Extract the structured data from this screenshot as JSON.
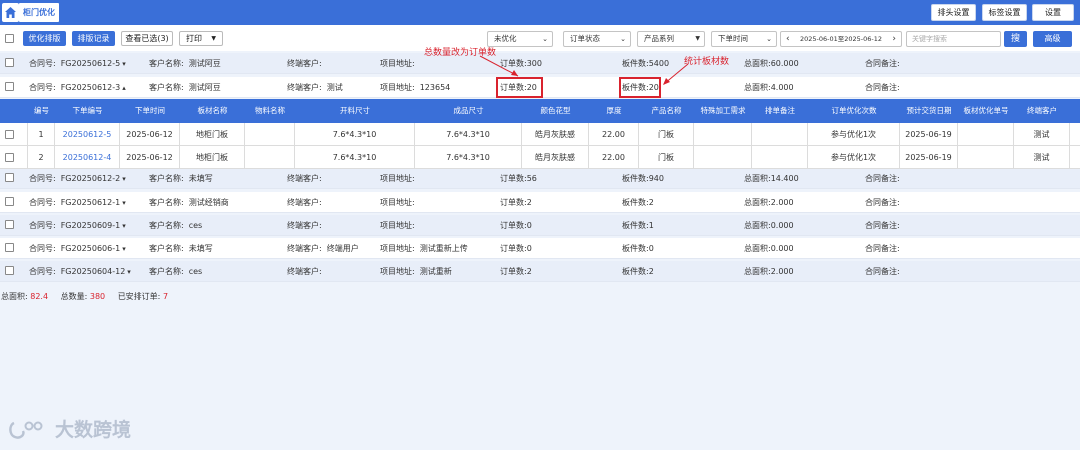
{
  "app": {
    "tab_label": "柜门优化"
  },
  "top_buttons": {
    "header_settings": "排头设置",
    "label_settings": "标签设置",
    "settings": "设置"
  },
  "toolbar": {
    "optimize_btn": "优化排版",
    "record_btn": "排版记录",
    "view_selected_btn": "查看已选(3)",
    "print_btn": "打印",
    "filter_optimize": "未优化",
    "filter_status": "订单状态",
    "filter_series": "产品系列",
    "filter_time": "下单时间",
    "date_range": "2025-06-01至2025-06-12",
    "search_placeholder": "关键字搜索",
    "search_btn": "搜",
    "advanced_btn": "高级"
  },
  "labels": {
    "contract": "合同号:",
    "customer": "客户名称:",
    "terminal": "终端客户:",
    "address": "项目地址:",
    "orders": "订单数:",
    "boards": "板件数:",
    "area": "总面积:",
    "remark": "合同备注:"
  },
  "orders": [
    {
      "contract": "FG20250612-5",
      "customer": "测试阿豆",
      "terminal": "",
      "address": "",
      "orders": "300",
      "boards": "5400",
      "area": "60.000",
      "remark": ""
    },
    {
      "contract": "FG20250612-3",
      "customer": "测试阿豆",
      "terminal": "测试",
      "address": "123654",
      "orders": "20",
      "boards": "20",
      "area": "4.000",
      "remark": ""
    },
    {
      "contract": "FG20250612-2",
      "customer": "未填写",
      "terminal": "",
      "address": "",
      "orders": "56",
      "boards": "940",
      "area": "14.400",
      "remark": ""
    },
    {
      "contract": "FG20250612-1",
      "customer": "测试经销商",
      "terminal": "",
      "address": "",
      "orders": "2",
      "boards": "2",
      "area": "2.000",
      "remark": ""
    },
    {
      "contract": "FG20250609-1",
      "customer": "ces",
      "terminal": "",
      "address": "",
      "orders": "0",
      "boards": "1",
      "area": "0.000",
      "remark": ""
    },
    {
      "contract": "FG20250606-1",
      "customer": "未填写",
      "terminal": "终端用户",
      "address": "测试重新上传",
      "orders": "0",
      "boards": "0",
      "area": "0.000",
      "remark": ""
    },
    {
      "contract": "FG20250604-12",
      "customer": "ces",
      "terminal": "",
      "address": "测试重新",
      "orders": "2",
      "boards": "2",
      "area": "2.000",
      "remark": ""
    }
  ],
  "expand_icons": [
    "chevron-down-icon",
    "chevron-up-icon",
    "chevron-down-icon",
    "chevron-down-icon",
    "chevron-down-icon",
    "chevron-down-icon",
    "chevron-down-icon"
  ],
  "detail_headers": [
    "编号",
    "下单编号",
    "下单时间",
    "板材名称",
    "物料名称",
    "开料尺寸",
    "成品尺寸",
    "颜色花型",
    "厚度",
    "产品名称",
    "特殊加工需求",
    "排单备注",
    "订单优化次数",
    "预计交货日期",
    "板材优化单号",
    "终端客户"
  ],
  "detail_rows": [
    [
      "1",
      "20250612-5",
      "2025-06-12",
      "地柜门板",
      "",
      "7.6*4.3*10",
      "7.6*4.3*10",
      "皓月灰肤感",
      "22.00",
      "门板",
      "",
      "",
      "参与优化1次",
      "2025-06-19",
      "",
      "测试"
    ],
    [
      "2",
      "20250612-4",
      "2025-06-12",
      "地柜门板",
      "",
      "7.6*4.3*10",
      "7.6*4.3*10",
      "皓月灰肤感",
      "22.00",
      "门板",
      "",
      "",
      "参与优化1次",
      "2025-06-19",
      "",
      "测试"
    ]
  ],
  "annotations": {
    "orders_note": "总数量改为订单数",
    "boards_note": "统计板材数"
  },
  "summary": {
    "area_label": "总面积:",
    "area_value": "82.4",
    "qty_label": "总数量:",
    "qty_value": "380",
    "scheduled_label": "已安排订单:",
    "scheduled_value": "7"
  },
  "watermark": {
    "text": "大数跨境"
  },
  "colors": {
    "primary": "#3a6fd8",
    "highlight": "#d9232e",
    "row_blue": "#e8eef9"
  }
}
